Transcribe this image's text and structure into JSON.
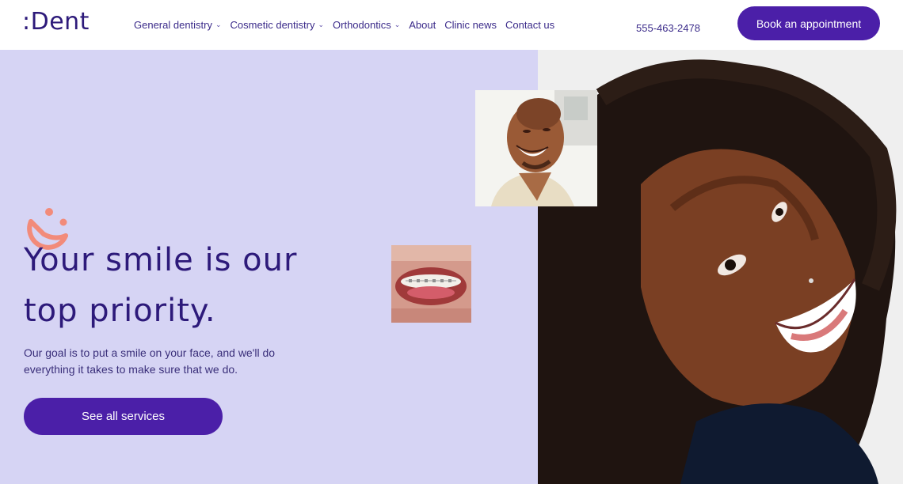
{
  "header": {
    "logo": ":Dent",
    "nav": [
      {
        "label": "General dentistry",
        "has_dropdown": true
      },
      {
        "label": "Cosmetic dentistry",
        "has_dropdown": true
      },
      {
        "label": "Orthodontics",
        "has_dropdown": true
      },
      {
        "label": "About",
        "has_dropdown": false
      },
      {
        "label": "Clinic news",
        "has_dropdown": false
      },
      {
        "label": "Contact us",
        "has_dropdown": false
      }
    ],
    "phone": "555-463-2478",
    "book_label": "Book an appointment"
  },
  "hero": {
    "headline_line1": "Your smile is our",
    "headline_line2": "top priority.",
    "subtext_line1": "Our goal is to put a smile on your face, and we'll do",
    "subtext_line2": "everything it takes to make sure that we do.",
    "services_label": "See all services"
  },
  "colors": {
    "accent": "#4b1fa8",
    "hero_bg": "#d6d4f4",
    "icon_coral": "#f28b7a",
    "heading": "#2d1a7a"
  },
  "icons": {
    "nav_dropdown": "chevron-down-icon",
    "brand_mark": "smile-logo-icon"
  }
}
